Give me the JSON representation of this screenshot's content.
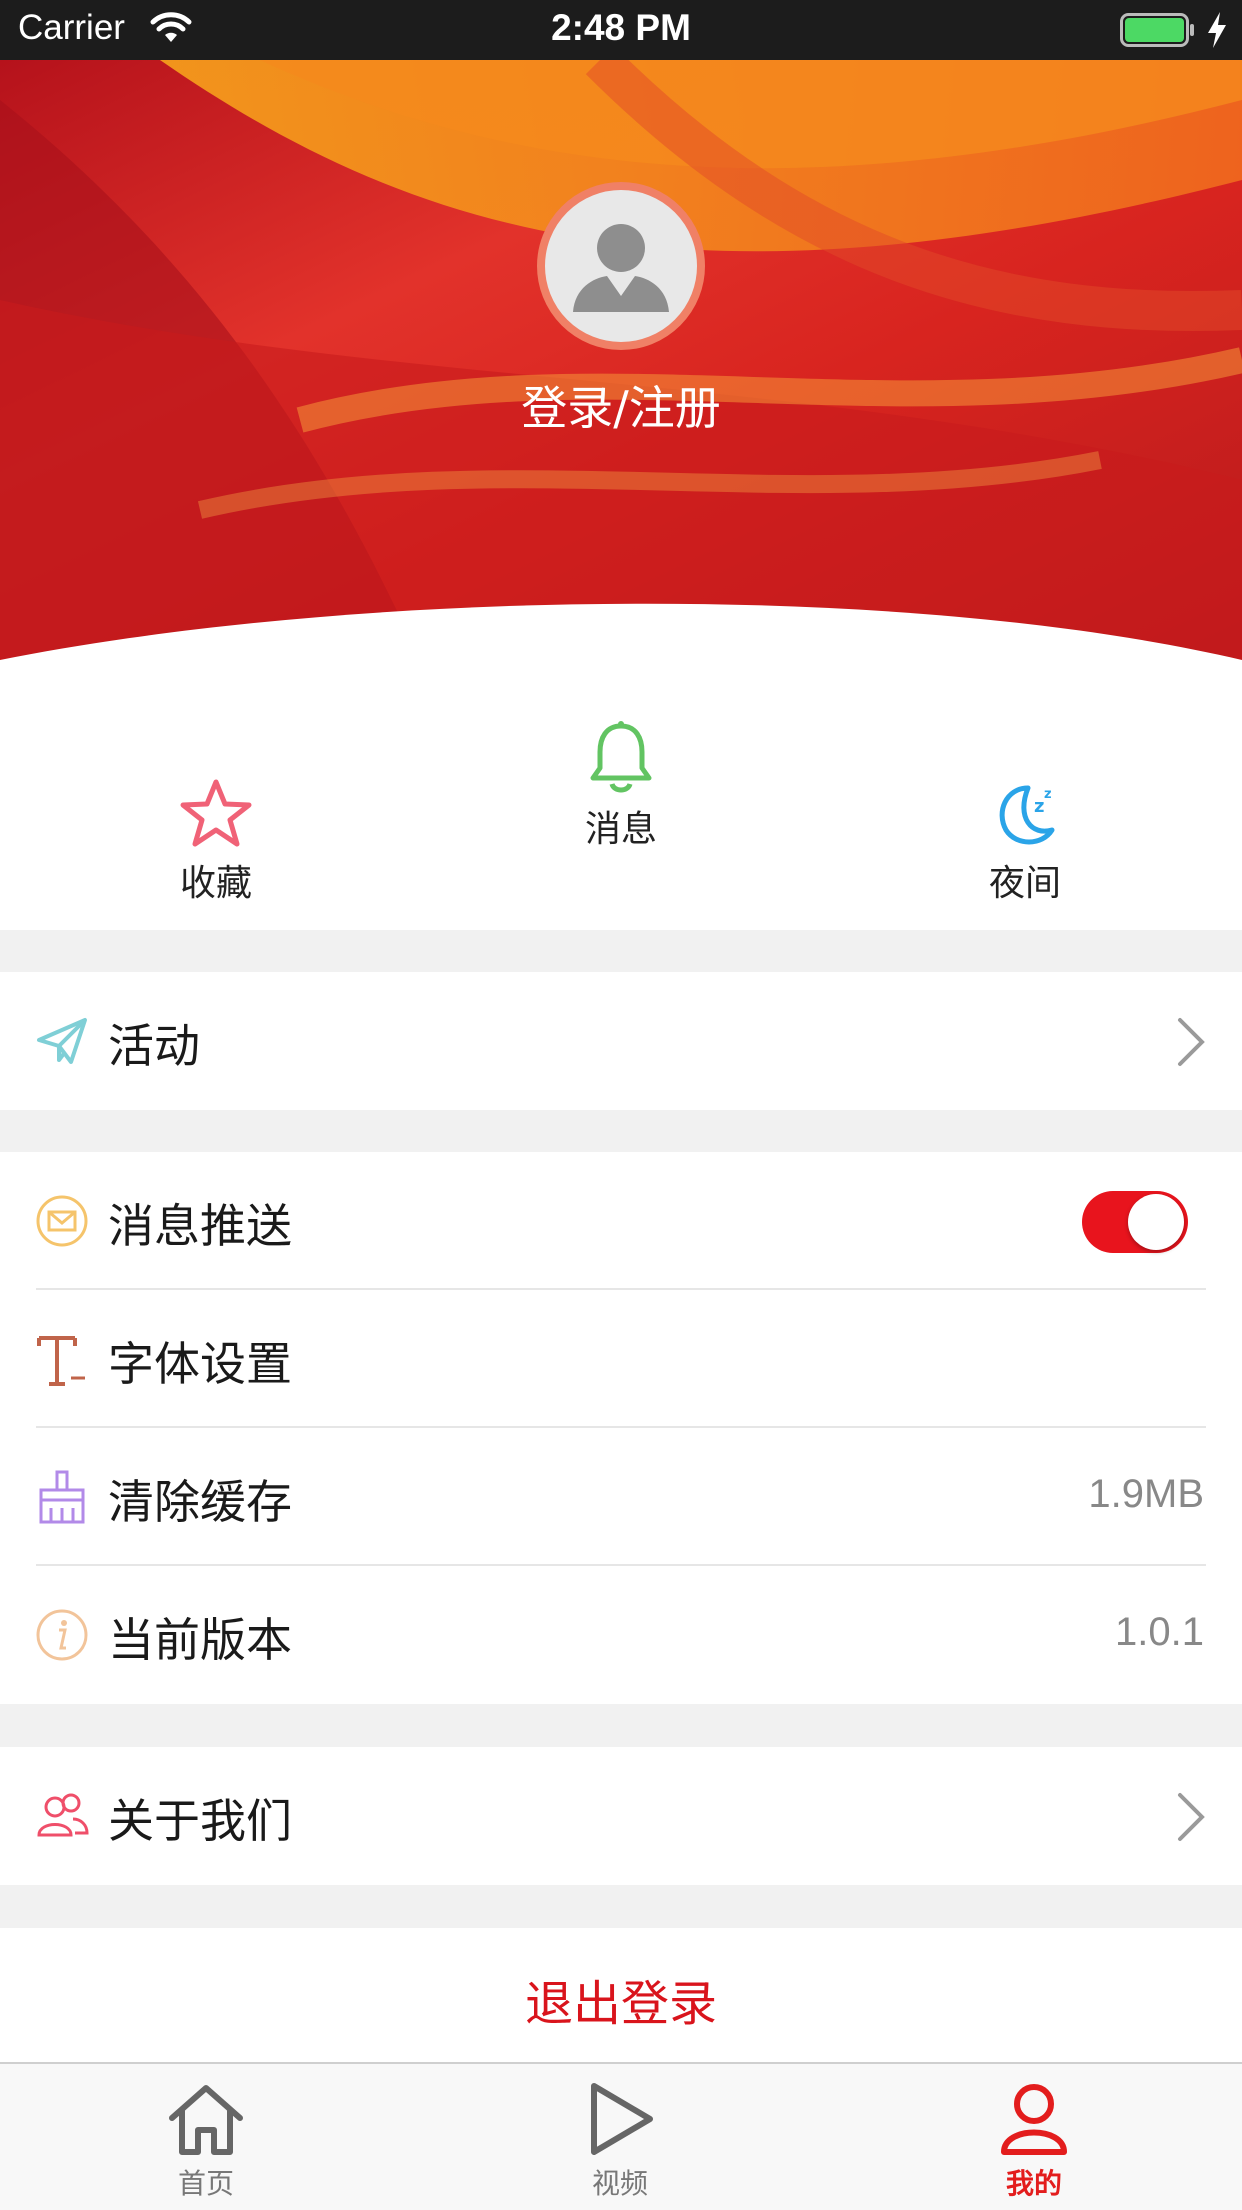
{
  "status_bar": {
    "carrier": "Carrier",
    "time": "2:48 PM"
  },
  "header": {
    "login_label": "登录/注册"
  },
  "shortcuts": [
    {
      "label": "收藏",
      "icon": "star-icon",
      "color": "#f06277"
    },
    {
      "label": "消息",
      "icon": "bell-icon",
      "color": "#62c462"
    },
    {
      "label": "夜间",
      "icon": "moon-icon",
      "color": "#2aa4e8"
    }
  ],
  "menu": {
    "activity": {
      "label": "活动",
      "icon": "paper-plane-icon"
    },
    "push": {
      "label": "消息推送",
      "icon": "mail-icon",
      "enabled": true
    },
    "font": {
      "label": "字体设置",
      "icon": "font-icon"
    },
    "cache": {
      "label": "清除缓存",
      "icon": "broom-icon",
      "value": "1.9MB"
    },
    "version": {
      "label": "当前版本",
      "icon": "info-icon",
      "value": "1.0.1"
    },
    "about": {
      "label": "关于我们",
      "icon": "users-icon"
    }
  },
  "logout_label": "退出登录",
  "tabbar": {
    "items": [
      {
        "label": "首页",
        "icon": "home-icon"
      },
      {
        "label": "视频",
        "icon": "play-icon"
      },
      {
        "label": "我的",
        "icon": "person-icon"
      }
    ],
    "active_index": 2,
    "active_color": "#e31d1d"
  },
  "colors": {
    "accent": "#d9141c",
    "toggle_on": "#e8141d"
  }
}
